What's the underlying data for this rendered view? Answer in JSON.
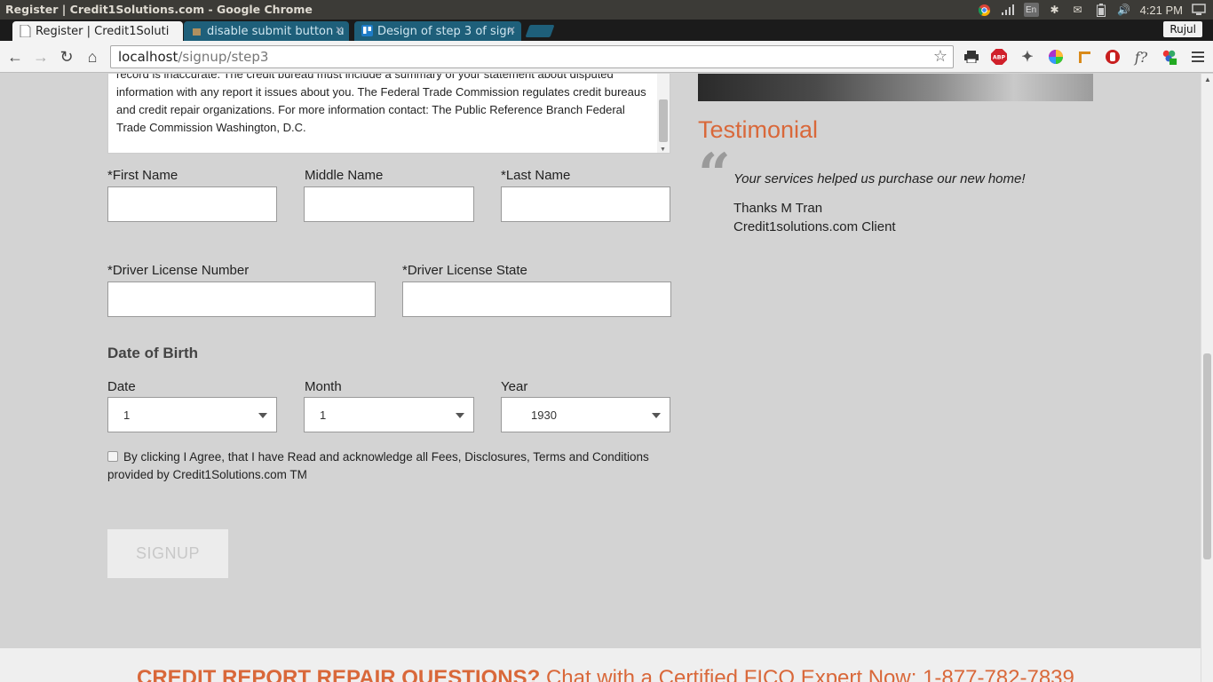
{
  "os": {
    "window_title": "Register | Credit1Solutions.com - Google Chrome",
    "clock": "4:21 PM",
    "tray_icons": [
      "chrome-icon",
      "signal-icon",
      "keyboard-en-icon",
      "bluetooth-icon",
      "mail-icon",
      "battery-icon",
      "volume-icon",
      "power-icon"
    ],
    "keyboard_label": "En"
  },
  "browser": {
    "tabs": [
      {
        "label": "Register | Credit1Soluti",
        "active": true
      },
      {
        "label": "disable submit button u",
        "active": false
      },
      {
        "label": "Design of step 3 of sign",
        "active": false
      }
    ],
    "profile_name": "Rujul",
    "url_host": "localhost",
    "url_path": "/signup/step3",
    "extensions": [
      "printer-icon",
      "adblock-icon",
      "eyedropper-icon",
      "color-wheel-icon",
      "ruler-icon",
      "stop-icon",
      "function-icon",
      "extension-badge-icon"
    ],
    "adblock_label": "ABP",
    "function_label": "f?"
  },
  "form": {
    "disclosure_text": "record is inaccurate. The credit bureau must include a summary of your statement about disputed information with any report it issues about you. The Federal Trade Commission regulates credit bureaus and credit repair organizations. For more information contact: The Public Reference Branch Federal Trade Commission Washington, D.C.",
    "first_name_label": "*First Name",
    "middle_name_label": "Middle Name",
    "last_name_label": "*Last Name",
    "dl_number_label": "*Driver License Number",
    "dl_state_label": "*Driver License State",
    "dob_heading": "Date of Birth",
    "date_label": "Date",
    "month_label": "Month",
    "year_label": "Year",
    "date_value": "1",
    "month_value": "1",
    "year_value": "1930",
    "agree_text": "By clicking I Agree, that I have Read and acknowledge all Fees, Disclosures, Terms and Conditions provided by Credit1Solutions.com TM",
    "agree_checked": false,
    "signup_label": "SIGNUP"
  },
  "sidebar": {
    "testimonial_title": "Testimonial",
    "quote_glyph": "“",
    "quote": "Your services helped us purchase our new home!",
    "author": "Thanks M Tran",
    "author_org": "Credit1solutions.com Client"
  },
  "footer": {
    "headline": "CREDIT REPORT REPAIR QUESTIONS?",
    "cta": "Chat with a Certified FICO Expert Now: 1-877-782-7839"
  },
  "colors": {
    "accent": "#d9683a",
    "page_bg": "#d3d3d3",
    "tab_inactive": "#1e5f7a"
  }
}
